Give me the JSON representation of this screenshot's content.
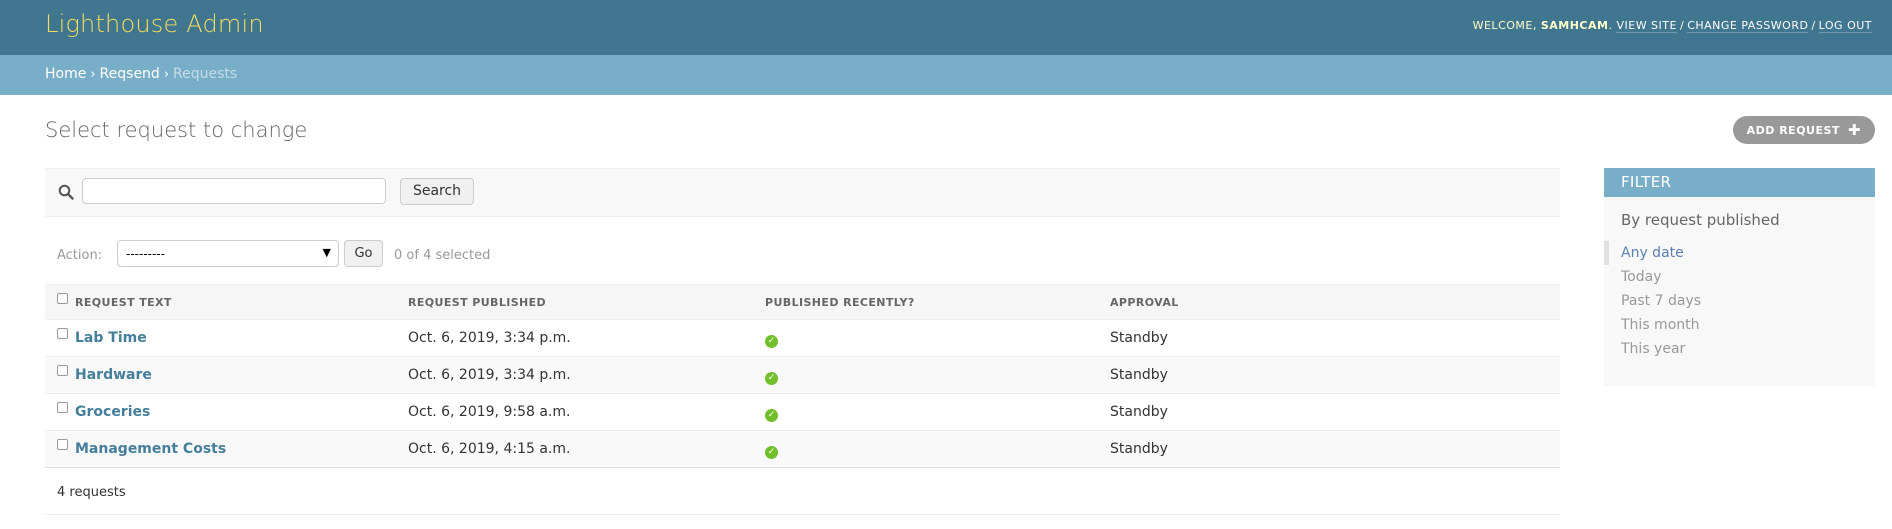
{
  "header": {
    "site_name": "Lighthouse Admin",
    "welcome": "Welcome,",
    "username": "samhcam",
    "view_site": "View site",
    "change_password": "Change password",
    "log_out": "Log out"
  },
  "breadcrumbs": {
    "home": "Home",
    "app": "Reqsend",
    "current": "Requests"
  },
  "page_title": "Select request to change",
  "add_button": "Add request",
  "search": {
    "value": "",
    "placeholder": "",
    "button": "Search"
  },
  "actions": {
    "label": "Action:",
    "selected_option": "---------",
    "go": "Go",
    "selected_count": "0 of 4 selected"
  },
  "table": {
    "columns": [
      "Request text",
      "Request published",
      "Published recently?",
      "Approval"
    ],
    "rows": [
      {
        "text": "Lab Time",
        "published": "Oct. 6, 2019, 3:34 p.m.",
        "recent": true,
        "approval": "Standby"
      },
      {
        "text": "Hardware",
        "published": "Oct. 6, 2019, 3:34 p.m.",
        "recent": true,
        "approval": "Standby"
      },
      {
        "text": "Groceries",
        "published": "Oct. 6, 2019, 9:58 a.m.",
        "recent": true,
        "approval": "Standby"
      },
      {
        "text": "Management Costs",
        "published": "Oct. 6, 2019, 4:15 a.m.",
        "recent": true,
        "approval": "Standby"
      }
    ]
  },
  "paginator": "4 requests",
  "filter": {
    "title": "Filter",
    "heading": "By request published",
    "options": [
      "Any date",
      "Today",
      "Past 7 days",
      "This month",
      "This year"
    ],
    "selected": "Any date"
  },
  "colors": {
    "header_bg": "#417690",
    "breadcrumbs_bg": "#79aec8",
    "brand_text": "#f5dd5d",
    "link": "#447e9b",
    "ok_green": "#70bf2b"
  },
  "icons": {
    "search": "search-icon",
    "add": "plus-icon",
    "recent": "check-circle-icon"
  }
}
